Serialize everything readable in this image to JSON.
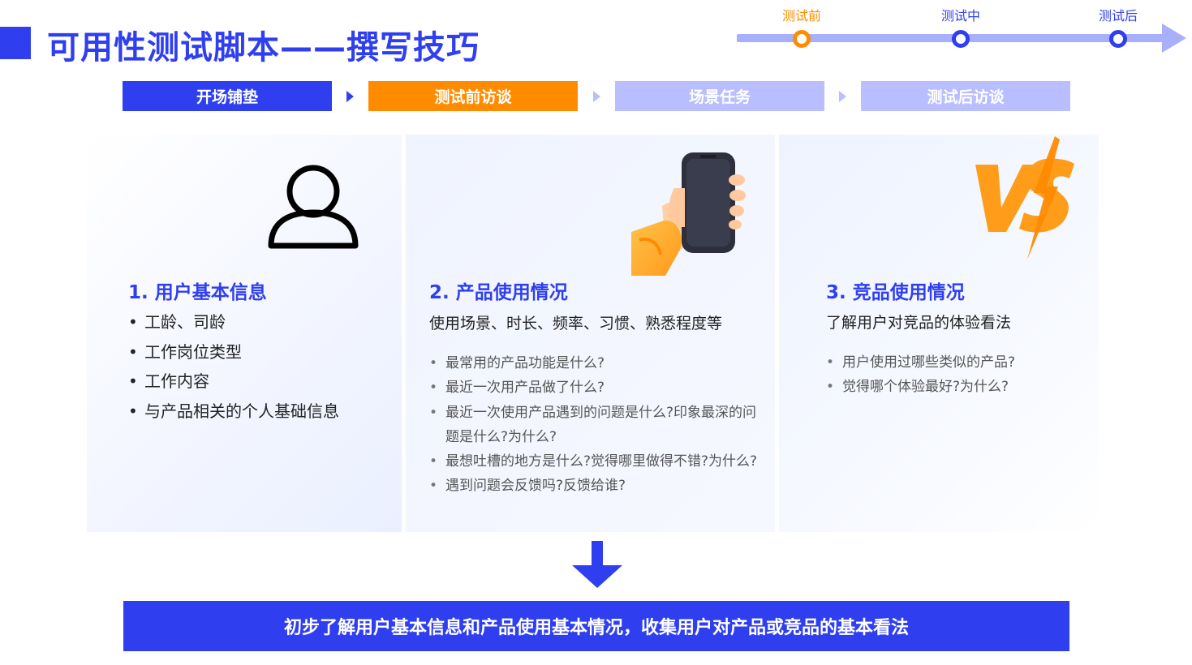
{
  "header": {
    "title": "可用性测试脚本——撰写技巧"
  },
  "timeline": {
    "steps": [
      "测试前",
      "测试中",
      "测试后"
    ]
  },
  "stages": [
    "开场铺垫",
    "测试前访谈",
    "场景任务",
    "测试后访谈"
  ],
  "cards": [
    {
      "title": "1. 用户基本信息",
      "items": [
        "工龄、司龄",
        "工作岗位类型",
        "工作内容",
        "与产品相关的个人基础信息"
      ]
    },
    {
      "title": "2. 产品使用情况",
      "subtitle": "使用场景、时长、频率、习惯、熟悉程度等",
      "items": [
        "最常用的产品功能是什么?",
        "最近一次用产品做了什么?",
        "最近一次使用产品遇到的问题是什么?印象最深的问题是什么?为什么?",
        "最想吐槽的地方是什么?觉得哪里做得不错?为什么?",
        "遇到问题会反馈吗?反馈给谁?"
      ]
    },
    {
      "title": "3. 竞品使用情况",
      "subtitle": "了解用户对竞品的体验看法",
      "items": [
        "用户使用过哪些类似的产品?",
        "觉得哪个体验最好?为什么?"
      ]
    }
  ],
  "summary": "初步了解用户基本信息和产品使用基本情况，收集用户对产品或竞品的基本看法",
  "colors": {
    "primary": "#2f3ff0",
    "accent": "#ff8c00",
    "light": "#b8beff"
  },
  "icons": [
    "user-icon",
    "phone-hand-icon",
    "vs-icon",
    "arrow-down-icon"
  ]
}
